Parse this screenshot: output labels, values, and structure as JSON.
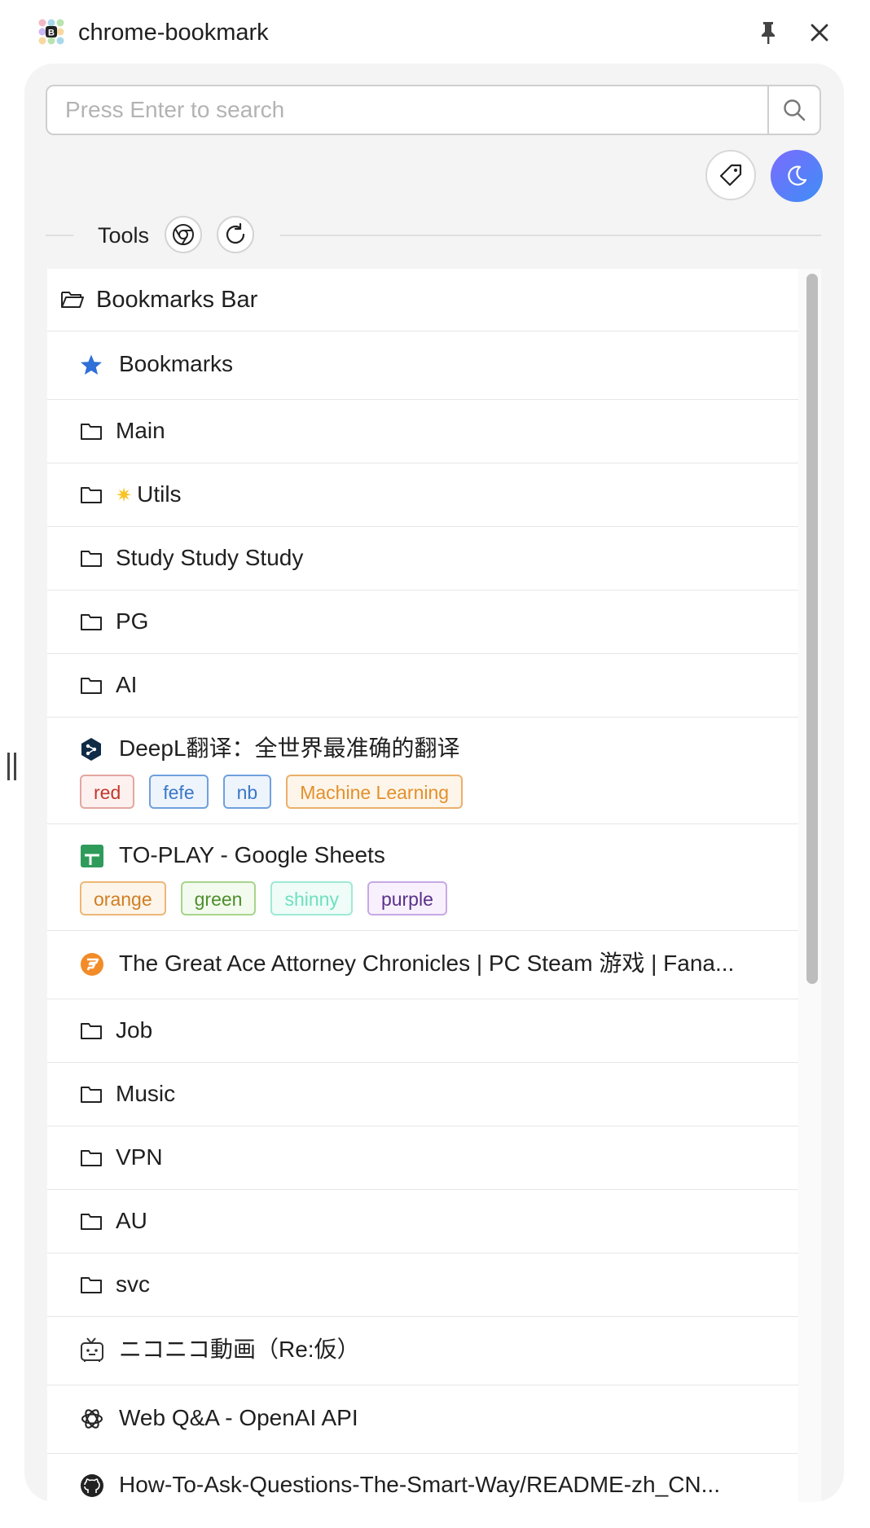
{
  "window": {
    "title": "chrome-bookmark"
  },
  "search": {
    "placeholder": "Press Enter to search",
    "value": ""
  },
  "toolbar": {
    "tools_label": "Tools"
  },
  "list": {
    "root_label": "Bookmarks Bar",
    "items": [
      {
        "type": "bookmark",
        "icon": "star-icon",
        "label": "Bookmarks"
      },
      {
        "type": "folder",
        "label": "Main"
      },
      {
        "type": "folder",
        "label": "Utils"
      },
      {
        "type": "folder",
        "label": "Study Study Study"
      },
      {
        "type": "folder",
        "label": "PG"
      },
      {
        "type": "folder",
        "label": "AI"
      },
      {
        "type": "bookmark",
        "icon": "deepl-icon",
        "label": "DeepL翻译：全世界最准确的翻译",
        "tags": [
          "red",
          "fefe",
          "nb",
          "Machine Learning"
        ]
      },
      {
        "type": "bookmark",
        "icon": "google-sheets-icon",
        "label": "TO-PLAY - Google Sheets",
        "tags": [
          "orange",
          "green",
          "shinny",
          "purple"
        ]
      },
      {
        "type": "bookmark",
        "icon": "fanatical-icon",
        "label": "The Great Ace Attorney Chronicles | PC Steam 游戏 | Fana..."
      },
      {
        "type": "folder",
        "label": "Job"
      },
      {
        "type": "folder",
        "label": "Music"
      },
      {
        "type": "folder",
        "label": "VPN"
      },
      {
        "type": "folder",
        "label": "AU"
      },
      {
        "type": "folder",
        "label": "svc"
      },
      {
        "type": "bookmark",
        "icon": "niconico-icon",
        "label": "ニコニコ動画（Re:仮）"
      },
      {
        "type": "bookmark",
        "icon": "openai-icon",
        "label": "Web Q&A - OpenAI API"
      },
      {
        "type": "bookmark",
        "icon": "github-icon",
        "label": "How-To-Ask-Questions-The-Smart-Way/README-zh_CN..."
      }
    ]
  },
  "colors": {
    "tag_red": "#c0392b",
    "tag_blue": "#3a78c8",
    "tag_orange": "#e3902b",
    "tag_green": "#4c8f2b",
    "tag_shinny": "#6de0c0",
    "tag_purple": "#5a2f8a",
    "accent_gradient_start": "#7b6bff",
    "accent_gradient_end": "#3e8ef5"
  }
}
